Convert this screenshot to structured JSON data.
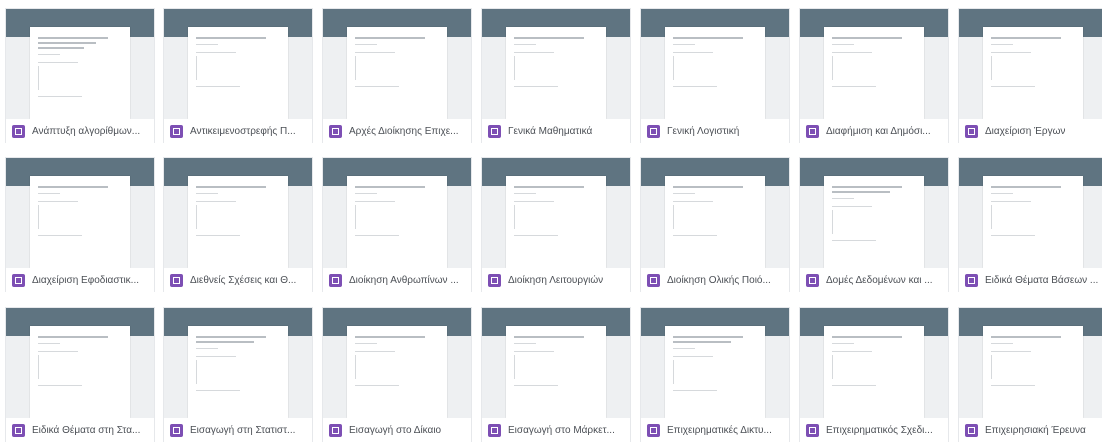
{
  "files": [
    {
      "name": "Ανάπτυξη αλγορίθμων...",
      "thumb_title": [
        "Ανάπτυξη αλγορίθμων",
        "και μοντέλων",
        "υπολογισμού"
      ]
    },
    {
      "name": "Αντικειμενοστρεφής Π...",
      "thumb_title": [
        "Αντικειμενοστρεφής Προγραμματισμός"
      ]
    },
    {
      "name": "Αρχές Διοίκησης Επιχε...",
      "thumb_title": [
        "Αρχές Διοίκησης Επιχειρήσεων"
      ]
    },
    {
      "name": "Γενικά Μαθηματικά",
      "thumb_title": [
        "Γενικά Μαθηματικά"
      ]
    },
    {
      "name": "Γενική Λογιστική",
      "thumb_title": [
        "Γενική Λογιστική"
      ]
    },
    {
      "name": "Διαφήμιση και Δημόσι...",
      "thumb_title": [
        "Διαφήμιση και Δημόσιες Σχέσεις"
      ]
    },
    {
      "name": "Διαχείριση Έργων",
      "thumb_title": [
        "Διαχείριση Έργων"
      ]
    },
    {
      "name": "Διαχείριση Εφοδιαστικ...",
      "thumb_title": [
        "Διαχείριση Εφοδιαστικής Αλυσίδας"
      ]
    },
    {
      "name": "Διεθνείς Σχέσεις και Θ...",
      "thumb_title": [
        "Διεθνείς Σχέσεις και Θεσμοί"
      ]
    },
    {
      "name": "Διοίκηση Ανθρωπίνων ...",
      "thumb_title": [
        "Διοίκηση Ανθρωπίνων Πόρων"
      ]
    },
    {
      "name": "Διοίκηση Λειτουργιών",
      "thumb_title": [
        "Διοίκηση Λειτουργιών"
      ]
    },
    {
      "name": "Διοίκηση Ολικής Ποιό...",
      "thumb_title": [
        "Διοίκηση Ολικής Ποιότητας"
      ]
    },
    {
      "name": "Δομές Δεδομένων και ...",
      "thumb_title": [
        "Δομές Δεδομένων και Τεχνικές",
        "Αλγορίθμων"
      ]
    },
    {
      "name": "Ειδικά Θέματα Βάσεων ...",
      "thumb_title": [
        "Ειδικά Θέματα Βάσεων Δεδομένων"
      ]
    },
    {
      "name": "Ειδικά Θέματα στη Στα...",
      "thumb_title": [
        "Ειδικά Θέματα στη Στατιστική"
      ]
    },
    {
      "name": "Εισαγωγή στη Στατιστ...",
      "thumb_title": [
        "Εισαγωγή στη Στατιστική και τις",
        "Πιθανότητες"
      ]
    },
    {
      "name": "Εισαγωγή στο Δίκαιο",
      "thumb_title": [
        "Εισαγωγή στο Δίκαιο"
      ]
    },
    {
      "name": "Εισαγωγή στο Μάρκετ...",
      "thumb_title": [
        "Εισαγωγή στο Μάρκετινγκ"
      ]
    },
    {
      "name": "Επιχειρηματικές Δικτυ...",
      "thumb_title": [
        "Επιχειρηματικές Δικτυακές",
        "Εφαρμογές"
      ]
    },
    {
      "name": "Επιχειρηματικός Σχεδι...",
      "thumb_title": [
        "Επιχειρηματικός Σχεδιασμός"
      ]
    },
    {
      "name": "Επιχειρησιακή Έρευνα",
      "thumb_title": [
        "Επιχειρησιακή Έρευνα"
      ]
    }
  ]
}
